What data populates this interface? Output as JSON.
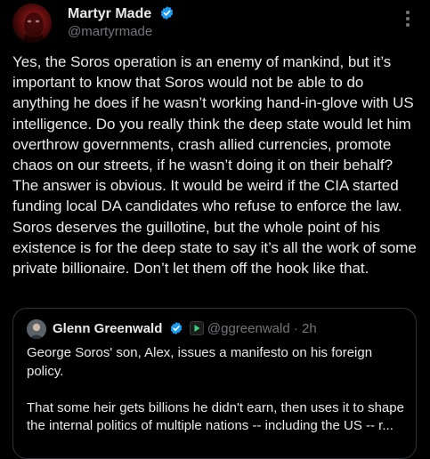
{
  "tweet": {
    "author_name": "Martyr Made",
    "handle": "@martyrmade",
    "text": "Yes, the Soros operation is an enemy of mankind, but it’s important to know that Soros would not be able to do anything he does if he wasn’t working hand-in-glove with US intelligence. Do you really think the deep state would let him overthrow governments, crash allied currencies, promote chaos on our streets, if he wasn’t doing it on their behalf? The answer is obvious. It would be weird if the CIA started funding local DA candidates who refuse to enforce the law. Soros deserves the guillotine, but the whole point of his existence is for the deep state to say it’s all the work of some private billionaire. Don’t let them off the hook like that.",
    "icons": {
      "verified": "verified-badge-icon",
      "more": "more-options-icon"
    }
  },
  "quoted_tweet": {
    "author_name": "Glenn Greenwald",
    "handle": "@ggreenwald",
    "separator": " · ",
    "time": "2h",
    "text": "George Soros' son, Alex, issues a manifesto on his foreign policy.\n\nThat some heir gets billions he didn't earn, then uses it to shape the internal politics of multiple nations -- including the US -- r...",
    "icons": {
      "verified": "verified-badge-icon",
      "affiliate": "affiliate-badge-icon"
    }
  },
  "colors": {
    "background": "#000000",
    "text": "#e7e9ea",
    "secondary": "#71767b",
    "verified": "#1d9bf0",
    "border": "#2f3336"
  }
}
